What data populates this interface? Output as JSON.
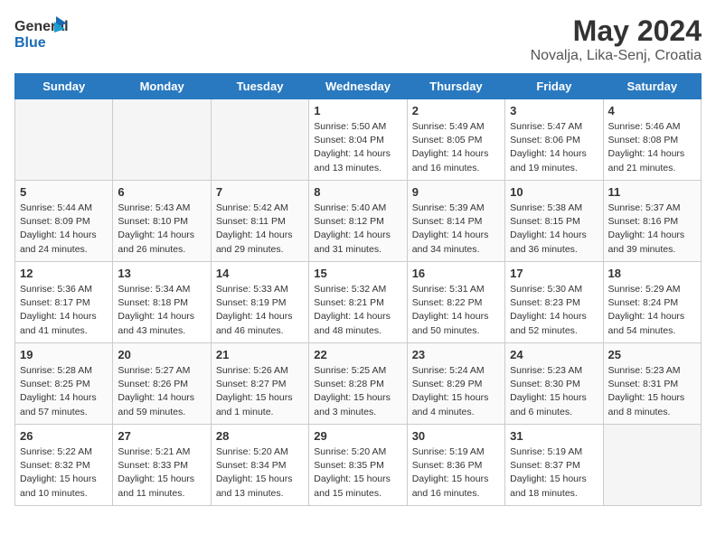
{
  "header": {
    "logo_line1": "General",
    "logo_line2": "Blue",
    "month": "May 2024",
    "location": "Novalja, Lika-Senj, Croatia"
  },
  "weekdays": [
    "Sunday",
    "Monday",
    "Tuesday",
    "Wednesday",
    "Thursday",
    "Friday",
    "Saturday"
  ],
  "weeks": [
    [
      {
        "day": "",
        "info": ""
      },
      {
        "day": "",
        "info": ""
      },
      {
        "day": "",
        "info": ""
      },
      {
        "day": "1",
        "info": "Sunrise: 5:50 AM\nSunset: 8:04 PM\nDaylight: 14 hours\nand 13 minutes."
      },
      {
        "day": "2",
        "info": "Sunrise: 5:49 AM\nSunset: 8:05 PM\nDaylight: 14 hours\nand 16 minutes."
      },
      {
        "day": "3",
        "info": "Sunrise: 5:47 AM\nSunset: 8:06 PM\nDaylight: 14 hours\nand 19 minutes."
      },
      {
        "day": "4",
        "info": "Sunrise: 5:46 AM\nSunset: 8:08 PM\nDaylight: 14 hours\nand 21 minutes."
      }
    ],
    [
      {
        "day": "5",
        "info": "Sunrise: 5:44 AM\nSunset: 8:09 PM\nDaylight: 14 hours\nand 24 minutes."
      },
      {
        "day": "6",
        "info": "Sunrise: 5:43 AM\nSunset: 8:10 PM\nDaylight: 14 hours\nand 26 minutes."
      },
      {
        "day": "7",
        "info": "Sunrise: 5:42 AM\nSunset: 8:11 PM\nDaylight: 14 hours\nand 29 minutes."
      },
      {
        "day": "8",
        "info": "Sunrise: 5:40 AM\nSunset: 8:12 PM\nDaylight: 14 hours\nand 31 minutes."
      },
      {
        "day": "9",
        "info": "Sunrise: 5:39 AM\nSunset: 8:14 PM\nDaylight: 14 hours\nand 34 minutes."
      },
      {
        "day": "10",
        "info": "Sunrise: 5:38 AM\nSunset: 8:15 PM\nDaylight: 14 hours\nand 36 minutes."
      },
      {
        "day": "11",
        "info": "Sunrise: 5:37 AM\nSunset: 8:16 PM\nDaylight: 14 hours\nand 39 minutes."
      }
    ],
    [
      {
        "day": "12",
        "info": "Sunrise: 5:36 AM\nSunset: 8:17 PM\nDaylight: 14 hours\nand 41 minutes."
      },
      {
        "day": "13",
        "info": "Sunrise: 5:34 AM\nSunset: 8:18 PM\nDaylight: 14 hours\nand 43 minutes."
      },
      {
        "day": "14",
        "info": "Sunrise: 5:33 AM\nSunset: 8:19 PM\nDaylight: 14 hours\nand 46 minutes."
      },
      {
        "day": "15",
        "info": "Sunrise: 5:32 AM\nSunset: 8:21 PM\nDaylight: 14 hours\nand 48 minutes."
      },
      {
        "day": "16",
        "info": "Sunrise: 5:31 AM\nSunset: 8:22 PM\nDaylight: 14 hours\nand 50 minutes."
      },
      {
        "day": "17",
        "info": "Sunrise: 5:30 AM\nSunset: 8:23 PM\nDaylight: 14 hours\nand 52 minutes."
      },
      {
        "day": "18",
        "info": "Sunrise: 5:29 AM\nSunset: 8:24 PM\nDaylight: 14 hours\nand 54 minutes."
      }
    ],
    [
      {
        "day": "19",
        "info": "Sunrise: 5:28 AM\nSunset: 8:25 PM\nDaylight: 14 hours\nand 57 minutes."
      },
      {
        "day": "20",
        "info": "Sunrise: 5:27 AM\nSunset: 8:26 PM\nDaylight: 14 hours\nand 59 minutes."
      },
      {
        "day": "21",
        "info": "Sunrise: 5:26 AM\nSunset: 8:27 PM\nDaylight: 15 hours\nand 1 minute."
      },
      {
        "day": "22",
        "info": "Sunrise: 5:25 AM\nSunset: 8:28 PM\nDaylight: 15 hours\nand 3 minutes."
      },
      {
        "day": "23",
        "info": "Sunrise: 5:24 AM\nSunset: 8:29 PM\nDaylight: 15 hours\nand 4 minutes."
      },
      {
        "day": "24",
        "info": "Sunrise: 5:23 AM\nSunset: 8:30 PM\nDaylight: 15 hours\nand 6 minutes."
      },
      {
        "day": "25",
        "info": "Sunrise: 5:23 AM\nSunset: 8:31 PM\nDaylight: 15 hours\nand 8 minutes."
      }
    ],
    [
      {
        "day": "26",
        "info": "Sunrise: 5:22 AM\nSunset: 8:32 PM\nDaylight: 15 hours\nand 10 minutes."
      },
      {
        "day": "27",
        "info": "Sunrise: 5:21 AM\nSunset: 8:33 PM\nDaylight: 15 hours\nand 11 minutes."
      },
      {
        "day": "28",
        "info": "Sunrise: 5:20 AM\nSunset: 8:34 PM\nDaylight: 15 hours\nand 13 minutes."
      },
      {
        "day": "29",
        "info": "Sunrise: 5:20 AM\nSunset: 8:35 PM\nDaylight: 15 hours\nand 15 minutes."
      },
      {
        "day": "30",
        "info": "Sunrise: 5:19 AM\nSunset: 8:36 PM\nDaylight: 15 hours\nand 16 minutes."
      },
      {
        "day": "31",
        "info": "Sunrise: 5:19 AM\nSunset: 8:37 PM\nDaylight: 15 hours\nand 18 minutes."
      },
      {
        "day": "",
        "info": ""
      }
    ]
  ]
}
